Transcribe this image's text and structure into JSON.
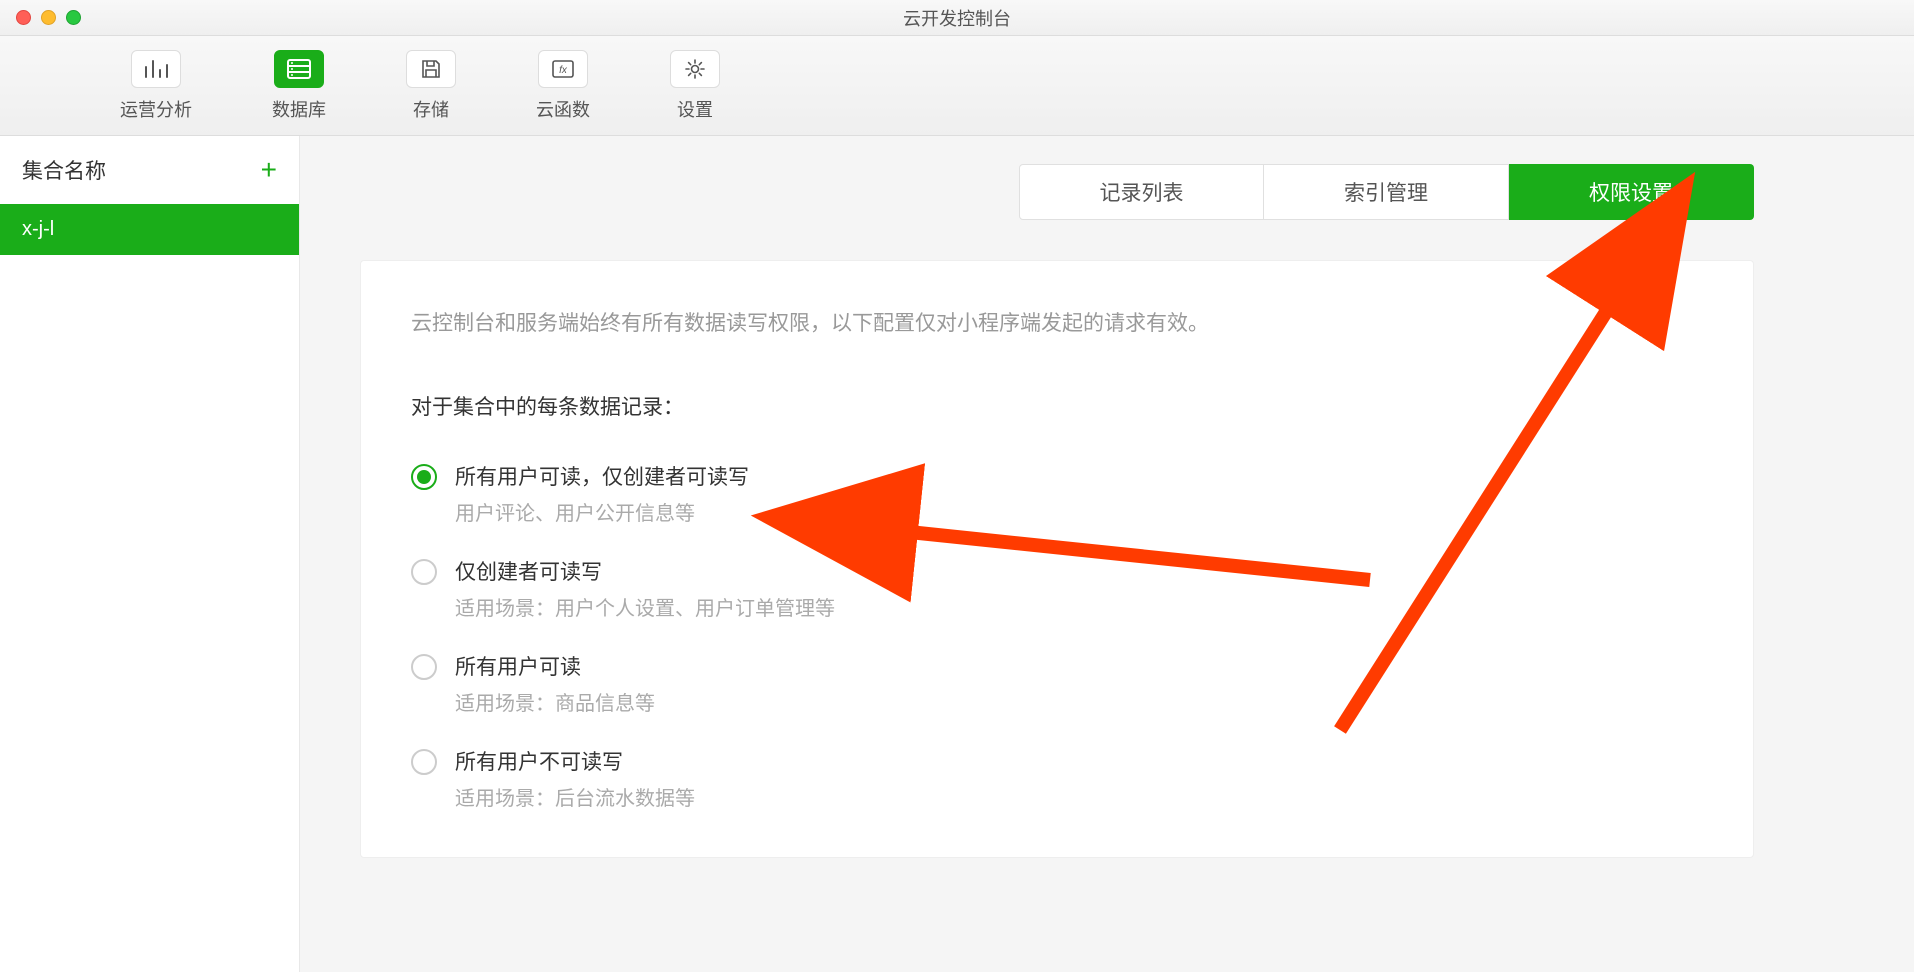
{
  "window": {
    "title": "云开发控制台"
  },
  "toolbar": {
    "items": [
      {
        "label": "运营分析",
        "icon": "analytics"
      },
      {
        "label": "数据库",
        "icon": "database",
        "active": true
      },
      {
        "label": "存储",
        "icon": "save"
      },
      {
        "label": "云函数",
        "icon": "function"
      },
      {
        "label": "设置",
        "icon": "settings"
      }
    ]
  },
  "sidebar": {
    "header_label": "集合名称",
    "collections": [
      {
        "name": "x-j-l",
        "selected": true
      }
    ]
  },
  "tabs": [
    {
      "label": "记录列表",
      "active": false
    },
    {
      "label": "索引管理",
      "active": false
    },
    {
      "label": "权限设置",
      "active": true
    }
  ],
  "panel": {
    "note": "云控制台和服务端始终有所有数据读写权限，以下配置仅对小程序端发起的请求有效。",
    "heading": "对于集合中的每条数据记录：",
    "options": [
      {
        "title": "所有用户可读，仅创建者可读写",
        "desc": "用户评论、用户公开信息等",
        "selected": true
      },
      {
        "title": "仅创建者可读写",
        "desc": "适用场景：用户个人设置、用户订单管理等",
        "selected": false
      },
      {
        "title": "所有用户可读",
        "desc": "适用场景：商品信息等",
        "selected": false
      },
      {
        "title": "所有用户不可读写",
        "desc": "适用场景：后台流水数据等",
        "selected": false
      }
    ]
  },
  "accent_color": "#1aad19",
  "annotation_color": "#ff3b00"
}
